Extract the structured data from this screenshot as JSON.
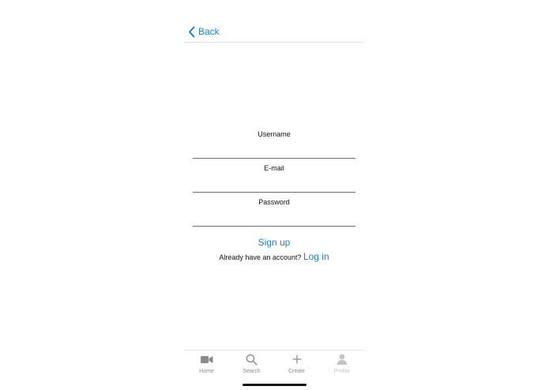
{
  "nav": {
    "back_label": "Back"
  },
  "form": {
    "username_label": "Username",
    "email_label": "E-mail",
    "password_label": "Password",
    "username_value": "",
    "email_value": "",
    "password_value": ""
  },
  "actions": {
    "signup_label": "Sign up",
    "login_prompt": "Already have an account?",
    "login_label": "Log in"
  },
  "tabs": [
    {
      "label": "Home",
      "icon": "video-camera-icon"
    },
    {
      "label": "Search",
      "icon": "search-icon"
    },
    {
      "label": "Create",
      "icon": "plus-icon"
    },
    {
      "label": "Profile",
      "icon": "person-icon"
    }
  ],
  "colors": {
    "accent": "#1b7fd6",
    "tab_inactive": "#8a8a8a",
    "tab_disabled": "#c4c4c4"
  }
}
